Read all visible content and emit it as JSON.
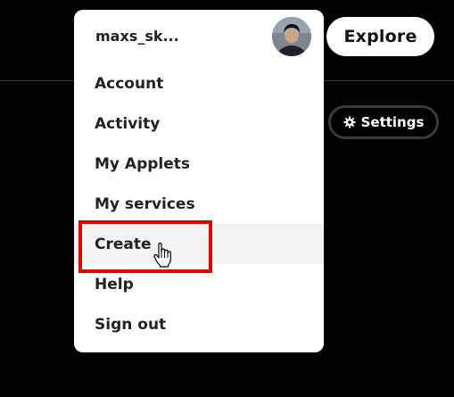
{
  "header": {
    "explore_label": "Explore",
    "settings_label": "Settings"
  },
  "user_menu": {
    "username": "maxs_sk...",
    "items": [
      {
        "label": "Account"
      },
      {
        "label": "Activity"
      },
      {
        "label": "My Applets"
      },
      {
        "label": "My services"
      },
      {
        "label": "Create"
      },
      {
        "label": "Help"
      },
      {
        "label": "Sign out"
      }
    ],
    "hovered_item": "Create"
  },
  "icons": {
    "settings": "gear-icon",
    "cursor": "hand-pointer-icon"
  },
  "colors": {
    "background": "#000000",
    "menu_background": "#ffffff",
    "menu_hover": "#f2f2f2",
    "highlight_annotation": "#e30000",
    "text_dark": "#222222",
    "settings_border": "#3b3b3b"
  }
}
